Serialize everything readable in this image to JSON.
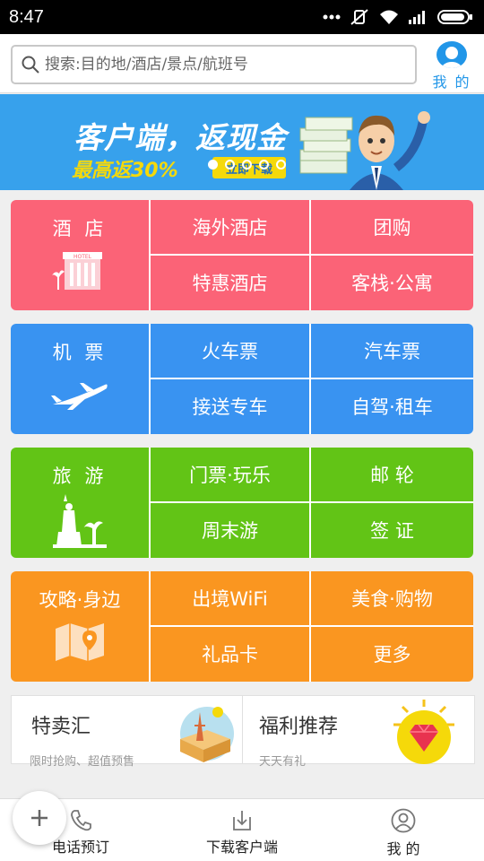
{
  "status_bar": {
    "time": "8:47"
  },
  "search": {
    "placeholder": "搜索:目的地/酒店/景点/航班号"
  },
  "header": {
    "mine_label": "我 的"
  },
  "banner": {
    "title": "客户端，返现金",
    "subtitle": "最高返30%",
    "cta": "立即下载"
  },
  "sections": [
    {
      "primary": "酒 店",
      "cells": [
        "海外酒店",
        "团购",
        "特惠酒店",
        "客栈·公寓"
      ],
      "color": "#fb6377"
    },
    {
      "primary": "机 票",
      "cells": [
        "火车票",
        "汽车票",
        "接送专车",
        "自驾·租车"
      ],
      "color": "#3993f1"
    },
    {
      "primary": "旅 游",
      "cells": [
        "门票·玩乐",
        "邮 轮",
        "周末游",
        "签 证"
      ],
      "color": "#62c416"
    },
    {
      "primary": "攻略·身边",
      "cells": [
        "出境WiFi",
        "美食·购物",
        "礼品卡",
        "更多"
      ],
      "color": "#fa9620"
    }
  ],
  "promos": [
    {
      "title": "特卖汇",
      "subtitle": "限时抢购、超值预售"
    },
    {
      "title": "福利推荐",
      "subtitle": "天天有礼"
    }
  ],
  "bottom_tabs": [
    {
      "label": "电话预订",
      "icon": "phone-icon"
    },
    {
      "label": "下载客户端",
      "icon": "download-icon"
    },
    {
      "label": "我 的",
      "icon": "user-icon"
    }
  ],
  "colors": {
    "accent": "#2196e8",
    "banner_bg": "#37a1ec",
    "banner_highlight": "#f5d90a"
  }
}
